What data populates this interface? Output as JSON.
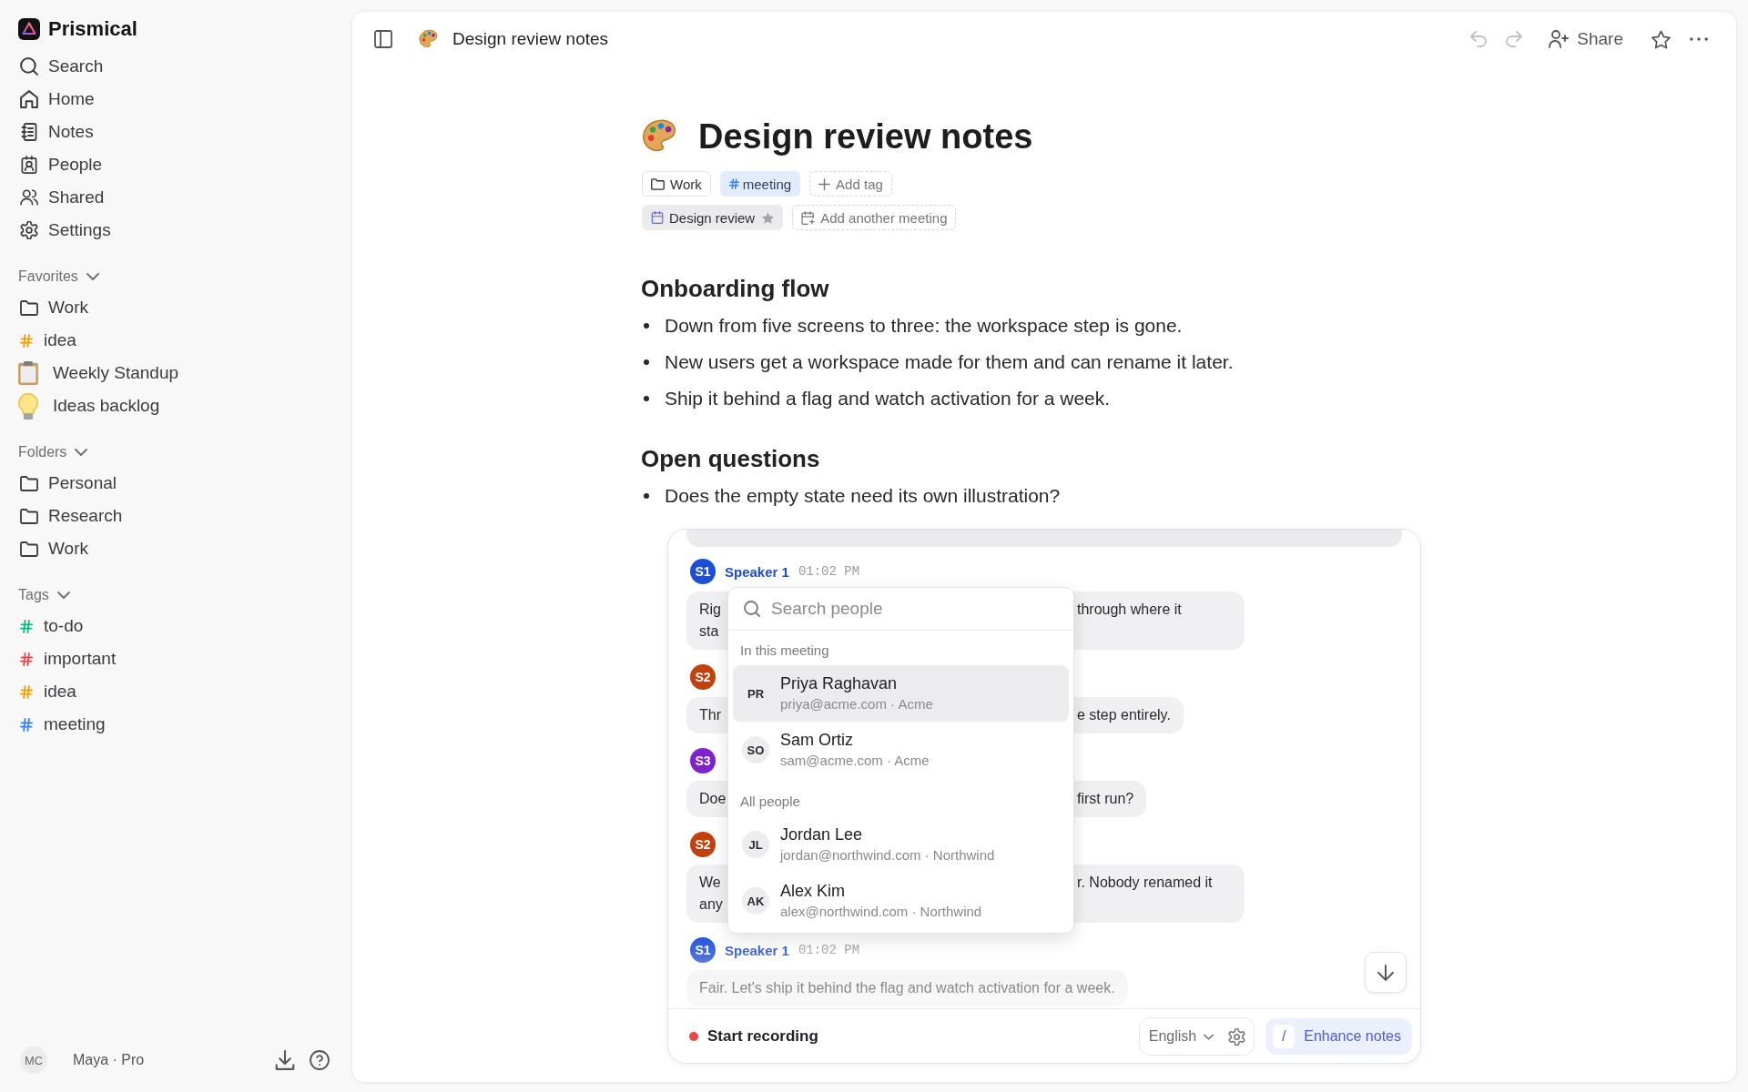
{
  "app": {
    "name": "Prismical"
  },
  "nav": [
    {
      "kind": "search",
      "label": "Search"
    },
    {
      "kind": "home",
      "label": "Home"
    },
    {
      "kind": "notes",
      "label": "Notes"
    },
    {
      "kind": "people",
      "label": "People"
    },
    {
      "kind": "shared",
      "label": "Shared"
    },
    {
      "kind": "settings",
      "label": "Settings"
    }
  ],
  "favorites": {
    "title": "Favorites",
    "expanded": true,
    "items": [
      {
        "kind": "folder",
        "label": "Work"
      },
      {
        "kind": "tag",
        "label": "idea",
        "color": "#f59e0b"
      },
      {
        "kind": "memo",
        "label": "Weekly Standup"
      },
      {
        "kind": "bulb",
        "label": "Ideas backlog"
      }
    ]
  },
  "folders": {
    "title": "Folders",
    "expanded": true,
    "items": [
      {
        "label": "Personal"
      },
      {
        "label": "Research"
      },
      {
        "label": "Work"
      }
    ]
  },
  "tags": {
    "title": "Tags",
    "expanded": true,
    "items": [
      {
        "label": "to-do",
        "color": "#10b981"
      },
      {
        "label": "important",
        "color": "#ef4444"
      },
      {
        "label": "idea",
        "color": "#f59e0b"
      },
      {
        "label": "meeting",
        "color": "#3b82f6"
      }
    ]
  },
  "user": {
    "initials": "MC",
    "label": "Maya · Pro"
  },
  "header": {
    "title": "Design review notes",
    "actions": [
      {
        "kind": "undo",
        "disabled": true
      },
      {
        "kind": "redo",
        "disabled": true
      },
      {
        "kind": "share",
        "label": "Share",
        "disabled": false
      },
      {
        "kind": "star",
        "disabled": false
      },
      {
        "kind": "more",
        "disabled": false
      }
    ]
  },
  "note": {
    "title": "Design review notes",
    "labels": [
      {
        "kind": "folder",
        "label": "Work"
      },
      {
        "kind": "tag",
        "label": "meeting",
        "color": "#3b82f6"
      },
      {
        "kind": "add",
        "label": "Add tag"
      }
    ],
    "meetings": [
      {
        "kind": "meeting",
        "label": "Design review"
      },
      {
        "kind": "add",
        "label": "Add another meeting"
      }
    ],
    "sections": [
      {
        "heading": "Onboarding flow",
        "bullets": [
          "Down from five screens to three: the workspace step is gone.",
          "New users get a workspace made for them and can rename it later.",
          "Ship it behind a flag and watch activation for a week."
        ]
      },
      {
        "heading": "Open questions",
        "bullets": [
          "Does the empty state need its own illustration?"
        ]
      }
    ]
  },
  "transcript": {
    "messages": [
      {
        "avatar": "S1",
        "color": "#1d4ed8",
        "name": "Speaker 1",
        "time": "01:02 PM",
        "lines": [
          {
            "left": "Rig",
            "right": "through where it"
          },
          {
            "left": "sta"
          }
        ]
      },
      {
        "avatar": "S2",
        "color": "#c2410c",
        "lines": [
          {
            "left": "Thr",
            "right": "e step entirely."
          }
        ]
      },
      {
        "avatar": "S3",
        "color": "#7e22ce",
        "lines": [
          {
            "left": "Doe",
            "right": "first run?"
          }
        ]
      },
      {
        "avatar": "S2",
        "color": "#c2410c",
        "lines": [
          {
            "left": "We",
            "right": "r. Nobody renamed it"
          },
          {
            "left": "any"
          }
        ]
      },
      {
        "avatar": "S1",
        "color": "#1d4ed8",
        "name": "Speaker 1",
        "time": "01:02 PM",
        "lines": [
          {
            "text": "Fair. Let's ship it behind the flag and watch activation for a week."
          }
        ]
      }
    ],
    "record_label": "Start recording",
    "language": "English",
    "enhance": {
      "key": "/",
      "label": "Enhance notes"
    }
  },
  "people_picker": {
    "placeholder": "Search people",
    "groups": [
      {
        "title": "In this meeting",
        "people": [
          {
            "initials": "PR",
            "name": "Priya Raghavan",
            "detail": "priya@acme.com · Acme",
            "selected": true
          },
          {
            "initials": "SO",
            "name": "Sam Ortiz",
            "detail": "sam@acme.com · Acme",
            "selected": false
          }
        ]
      },
      {
        "title": "All people",
        "people": [
          {
            "initials": "JL",
            "name": "Jordan Lee",
            "detail": "jordan@northwind.com · Northwind",
            "selected": false
          },
          {
            "initials": "AK",
            "name": "Alex Kim",
            "detail": "alex@northwind.com · Northwind",
            "selected": false
          }
        ]
      }
    ]
  }
}
